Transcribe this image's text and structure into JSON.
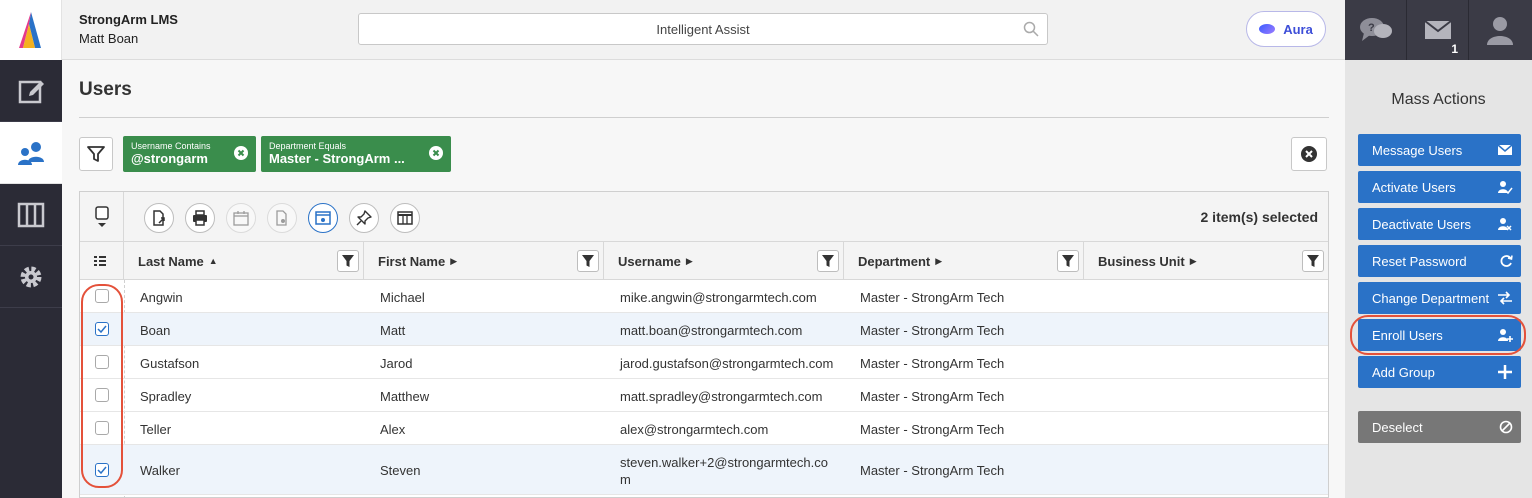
{
  "header": {
    "org_name": "StrongArm LMS",
    "user_name": "Matt Boan",
    "search_placeholder": "Intelligent Assist",
    "aura_label": "Aura",
    "message_badge": "1"
  },
  "nav": {
    "items": [
      "edit-icon",
      "users-icon",
      "columns-icon",
      "gear-icon"
    ]
  },
  "page": {
    "title": "Users"
  },
  "filters": [
    {
      "label": "Username Contains",
      "value": "@strongarm"
    },
    {
      "label": "Department Equals",
      "value": "Master - StrongArm ..."
    }
  ],
  "grid": {
    "selected_text": "2 item(s) selected",
    "columns": [
      {
        "label": "Last Name",
        "sort": "▲"
      },
      {
        "label": "First Name",
        "sort": "▶"
      },
      {
        "label": "Username",
        "sort": "▶"
      },
      {
        "label": "Department",
        "sort": "▶"
      },
      {
        "label": "Business Unit",
        "sort": "▶"
      }
    ],
    "rows": [
      {
        "checked": false,
        "last": "Angwin",
        "first": "Michael",
        "username": "mike.angwin@strongarmtech.com",
        "department": "Master - StrongArm Tech",
        "business_unit": ""
      },
      {
        "checked": true,
        "last": "Boan",
        "first": "Matt",
        "username": "matt.boan@strongarmtech.com",
        "department": "Master - StrongArm Tech",
        "business_unit": ""
      },
      {
        "checked": false,
        "last": "Gustafson",
        "first": "Jarod",
        "username": "jarod.gustafson@strongarmtech.com",
        "department": "Master - StrongArm Tech",
        "business_unit": ""
      },
      {
        "checked": false,
        "last": "Spradley",
        "first": "Matthew",
        "username": "matt.spradley@strongarmtech.com",
        "department": "Master - StrongArm Tech",
        "business_unit": ""
      },
      {
        "checked": false,
        "last": "Teller",
        "first": "Alex",
        "username": "alex@strongarmtech.com",
        "department": "Master - StrongArm Tech",
        "business_unit": ""
      },
      {
        "checked": true,
        "last": "Walker",
        "first": "Steven",
        "username": "steven.walker+2@strongarmtech.co",
        "username_wrap": "m",
        "department": "Master - StrongArm Tech",
        "business_unit": ""
      }
    ]
  },
  "mass_actions": {
    "title": "Mass Actions",
    "buttons": [
      {
        "label": "Message Users",
        "icon": "envelope-icon"
      },
      {
        "label": "Activate Users",
        "icon": "user-check-icon"
      },
      {
        "label": "Deactivate Users",
        "icon": "user-x-icon"
      },
      {
        "label": "Reset Password",
        "icon": "refresh-icon"
      },
      {
        "label": "Change Department",
        "icon": "swap-icon"
      },
      {
        "label": "Enroll Users",
        "icon": "user-plus-icon"
      },
      {
        "label": "Add Group",
        "icon": "plus-icon"
      }
    ],
    "deselect_label": "Deselect"
  },
  "colors": {
    "primary": "#2a72c7",
    "chip_green": "#3a8d4c",
    "highlight_ring": "#e4513a",
    "nav_dark": "#2b2b36"
  }
}
